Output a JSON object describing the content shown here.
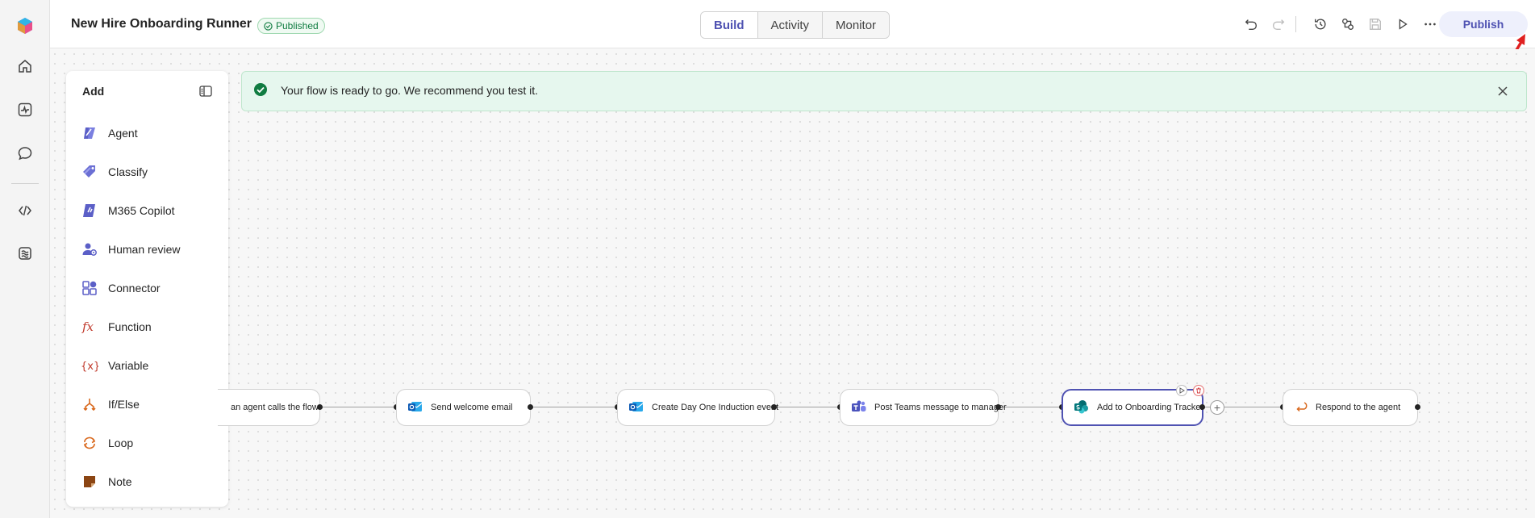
{
  "header": {
    "title": "New Hire Onboarding Runner",
    "status_badge": "Published",
    "tabs": [
      {
        "label": "Build",
        "active": true
      },
      {
        "label": "Activity",
        "active": false
      },
      {
        "label": "Monitor",
        "active": false
      }
    ],
    "publish_label": "Publish"
  },
  "banner": {
    "message": "Your flow is ready to go. We recommend you test it."
  },
  "panel": {
    "title": "Add",
    "items": [
      {
        "label": "Agent",
        "icon": "agent-icon"
      },
      {
        "label": "Classify",
        "icon": "tag-icon"
      },
      {
        "label": "M365 Copilot",
        "icon": "copilot-icon"
      },
      {
        "label": "Human review",
        "icon": "person-icon"
      },
      {
        "label": "Connector",
        "icon": "connector-icon"
      },
      {
        "label": "Function",
        "icon": "function-icon"
      },
      {
        "label": "Variable",
        "icon": "variable-icon"
      },
      {
        "label": "If/Else",
        "icon": "branch-icon"
      },
      {
        "label": "Loop",
        "icon": "loop-icon"
      },
      {
        "label": "Note",
        "icon": "note-icon"
      }
    ]
  },
  "flow": {
    "nodes": [
      {
        "label": "an agent calls the flow",
        "icon": "trigger-icon"
      },
      {
        "label": "Send welcome email",
        "icon": "outlook-icon"
      },
      {
        "label": "Create Day One Induction event",
        "icon": "outlook-icon"
      },
      {
        "label": "Post Teams message to manager",
        "icon": "teams-icon"
      },
      {
        "label": "Add to Onboarding Tracker",
        "icon": "sharepoint-icon",
        "selected": true
      },
      {
        "label": "Respond to the agent",
        "icon": "respond-icon"
      }
    ]
  },
  "colors": {
    "accent": "#4f52b2",
    "success": "#107c41",
    "banner_bg": "#e6f7ee"
  }
}
